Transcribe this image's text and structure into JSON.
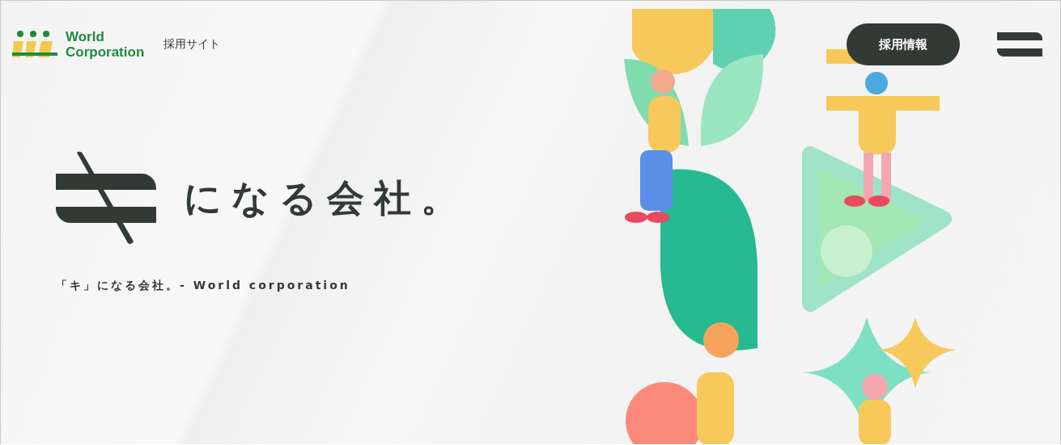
{
  "header": {
    "logo_lines": [
      "World",
      "Corporation"
    ],
    "site_label": "採用サイト",
    "button": "採用情報"
  },
  "hero": {
    "tagline": "になる会社。",
    "subtitle": "「キ」になる会社。- World corporation"
  }
}
